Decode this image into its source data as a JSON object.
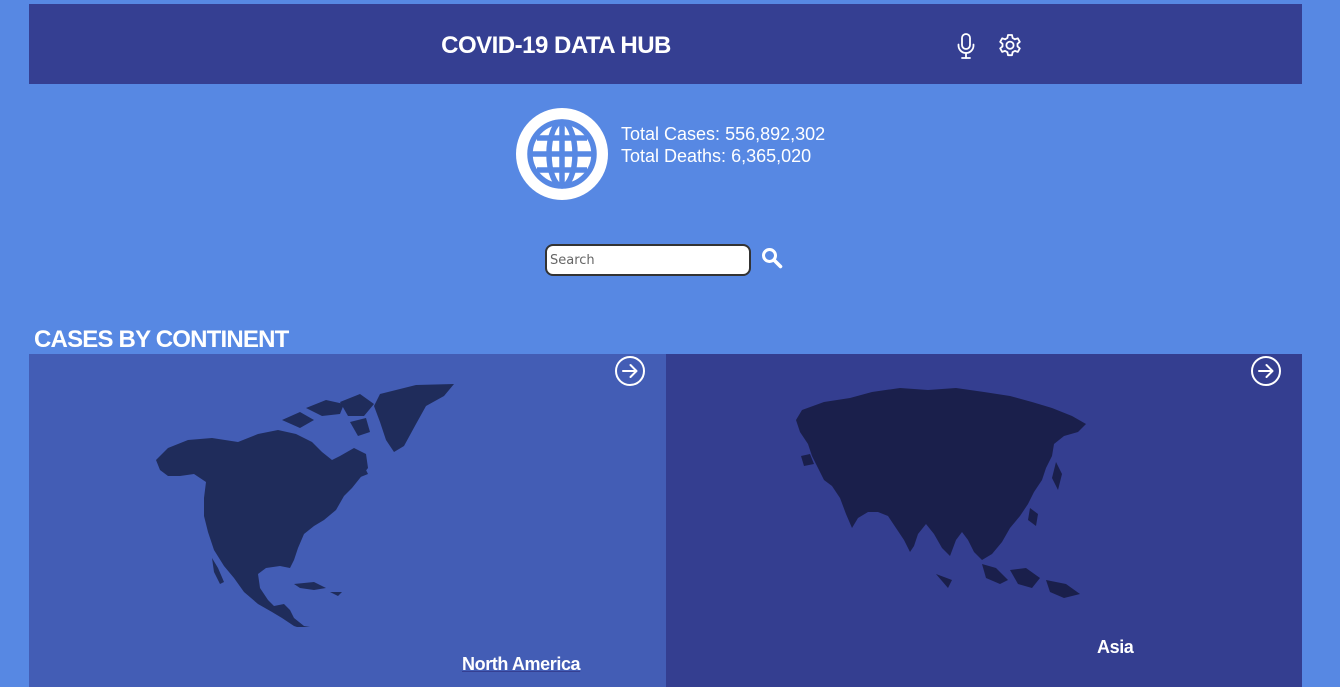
{
  "header": {
    "title": "COVID-19 DATA HUB",
    "icons": [
      "microphone-icon",
      "settings-gear-icon"
    ]
  },
  "summary": {
    "icon": "globe-icon",
    "total_cases_label": "Total Cases:",
    "total_cases": "556,892,302",
    "total_deaths_label": "Total Deaths:",
    "total_deaths": "6,365,020"
  },
  "search": {
    "placeholder": "Search",
    "value": "",
    "icon": "magnifier-icon"
  },
  "continents": {
    "title": "CASES BY CONTINENT",
    "cards": [
      {
        "name": "North America",
        "icon": "arrow-right-circle-icon",
        "map": "north-america-map"
      },
      {
        "name": "Asia",
        "icon": "arrow-right-circle-icon",
        "map": "asia-map"
      }
    ]
  },
  "colors": {
    "page_bg": "#5788e3",
    "header_bg": "#353f92",
    "card_na_bg": "#435db5",
    "card_asia_bg": "#343e90",
    "map_fill_na": "#1f2c5b",
    "map_fill_asia": "#1a1f4b",
    "text": "#ffffff"
  }
}
